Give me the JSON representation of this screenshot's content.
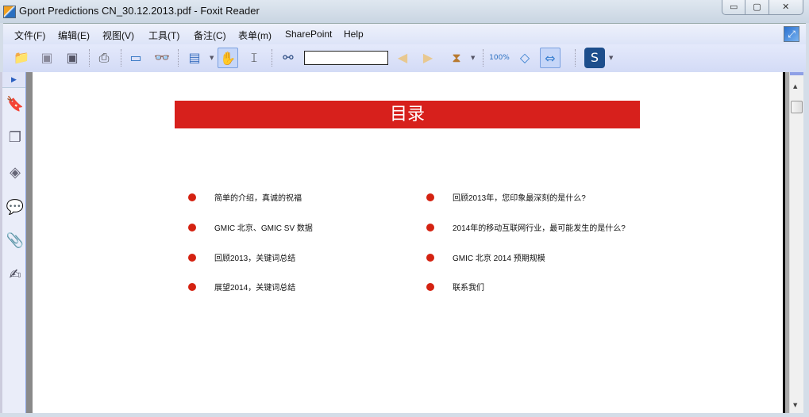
{
  "window": {
    "title": "Gport Predictions CN_30.12.2013.pdf - Foxit Reader",
    "min": "▭",
    "max": "▢",
    "close": "✕"
  },
  "menu": [
    "文件(F)",
    "编辑(E)",
    "视图(V)",
    "工具(T)",
    "备注(C)",
    "表单(m)",
    "SharePoint",
    "Help"
  ],
  "toolbar": {
    "search_value": ""
  },
  "page": {
    "title": "目录",
    "items_left": [
      "简单的介绍，真诚的祝福",
      "GMIC 北京、GMIC SV 数据",
      "回顾2013，关键词总结",
      "展望2014，关键词总结"
    ],
    "items_right": [
      "回顾2013年，您印象最深刻的是什么?",
      "2014年的移动互联网行业，最可能发生的是什么?",
      "GMIC 北京 2014 预期规模",
      "联系我们"
    ]
  },
  "colors": {
    "banner": "#d7201c",
    "bullet": "#d42211"
  }
}
